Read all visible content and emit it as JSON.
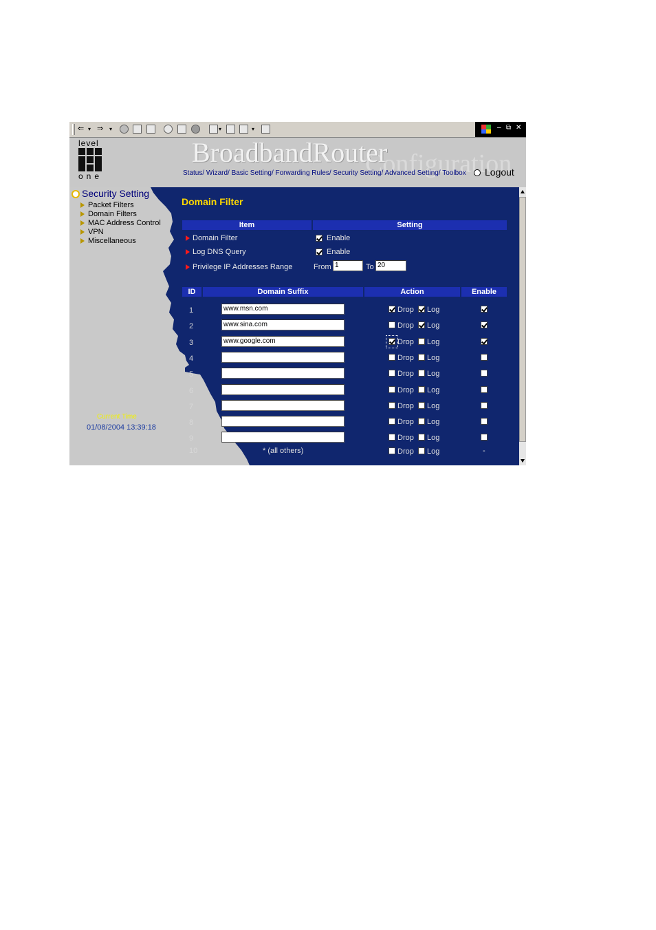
{
  "header": {
    "logo_top": "level",
    "logo_bottom": "one",
    "brand": "BroadbandRouter",
    "brand_sub": "Configuration",
    "nav": "Status/ Wizard/ Basic Setting/ Forwarding Rules/ Security Setting/ Advanced Setting/ Toolbox",
    "logout": "Logout"
  },
  "sidebar": {
    "title": "Security Setting",
    "items": [
      "Packet Filters",
      "Domain Filters",
      "MAC Address Control",
      "VPN",
      "Miscellaneous"
    ],
    "current_time_label": "Current Time",
    "current_time_value": "01/08/2004 13:39:18"
  },
  "main": {
    "title": "Domain Filter",
    "settings_header": {
      "item": "Item",
      "setting": "Setting"
    },
    "settings": {
      "domain_filter": {
        "label": "Domain Filter",
        "checked": true,
        "option": "Enable"
      },
      "log_dns": {
        "label": "Log DNS Query",
        "checked": true,
        "option": "Enable"
      },
      "privilege_ip": {
        "label": "Privilege IP Addresses Range",
        "from_label": "From",
        "from_value": "1",
        "to_label": "To",
        "to_value": "20"
      }
    },
    "table_header": {
      "id": "ID",
      "suffix": "Domain Suffix",
      "action": "Action",
      "enable": "Enable"
    },
    "drop_label": "Drop",
    "log_label": "Log",
    "rows": [
      {
        "id": "1",
        "suffix": "www.msn.com",
        "drop": true,
        "log": true,
        "enable": true
      },
      {
        "id": "2",
        "suffix": "www.sina.com",
        "drop": false,
        "log": true,
        "enable": true
      },
      {
        "id": "3",
        "suffix": "www.google.com",
        "drop": true,
        "log": false,
        "enable": true
      },
      {
        "id": "4",
        "suffix": "",
        "drop": false,
        "log": false,
        "enable": false
      },
      {
        "id": "5",
        "suffix": "",
        "drop": false,
        "log": false,
        "enable": false
      },
      {
        "id": "6",
        "suffix": "",
        "drop": false,
        "log": false,
        "enable": false
      },
      {
        "id": "7",
        "suffix": "",
        "drop": false,
        "log": false,
        "enable": false
      },
      {
        "id": "8",
        "suffix": "",
        "drop": false,
        "log": false,
        "enable": false
      },
      {
        "id": "9",
        "suffix": "",
        "drop": false,
        "log": false,
        "enable": false
      }
    ],
    "last_row": {
      "id": "10",
      "suffix": "* (all others)",
      "drop": false,
      "log": false,
      "enable": "-"
    }
  }
}
